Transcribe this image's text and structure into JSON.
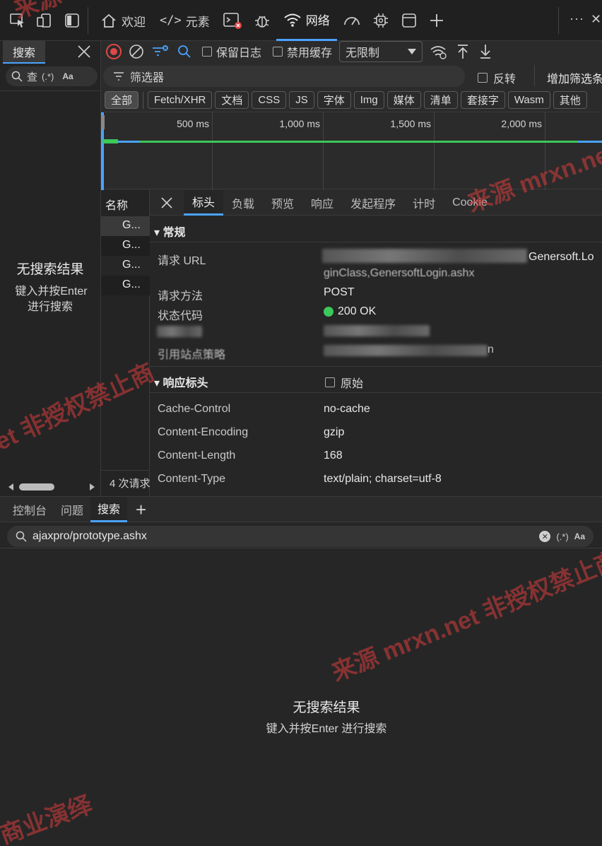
{
  "toolbar": {
    "tabs": [
      {
        "label": "欢迎"
      },
      {
        "label": "元素"
      },
      {
        "label": "网络"
      }
    ],
    "more": "···",
    "close": "✕"
  },
  "left_panel": {
    "tab_label": "搜索",
    "search_placeholder": "查",
    "regex": "(.*)",
    "case": "Aa",
    "no_results": "无搜索结果",
    "hint_line1": "键入并按Enter",
    "hint_line2": "进行搜索"
  },
  "network": {
    "preserve_log": "保留日志",
    "disable_cache": "禁用缓存",
    "throttle": "无限制",
    "filter_placeholder": "筛选器",
    "invert": "反转",
    "more_filters": "增加筛选条件",
    "type_filters": [
      "全部",
      "Fetch/XHR",
      "文档",
      "CSS",
      "JS",
      "字体",
      "Img",
      "媒体",
      "清单",
      "套接字",
      "Wasm",
      "其他"
    ],
    "timeline_ticks": [
      "500 ms",
      "1,000 ms",
      "1,500 ms",
      "2,000 ms"
    ],
    "name_header": "名称",
    "requests": [
      "G...",
      "G...",
      "G...",
      "G..."
    ],
    "status_count": "4 次请求"
  },
  "details": {
    "tabs": [
      "标头",
      "负载",
      "预览",
      "响应",
      "发起程序",
      "计时",
      "Cookie"
    ],
    "general": {
      "title": "▾ 常规",
      "request_url_label": "请求 URL",
      "request_url_value_tail": "Genersoft.Lo",
      "request_url_value_line2": "ginClass,GenersoftLogin.ashx",
      "method_label": "请求方法",
      "method_value": "POST",
      "status_label": "状态代码",
      "status_value": "200 OK",
      "referrer_label": "引用站点策略",
      "referrer_value": "n"
    },
    "response_headers": {
      "title": "▾ 响应标头",
      "raw_label": "原始",
      "rows": [
        {
          "name": "Cache-Control",
          "value": "no-cache"
        },
        {
          "name": "Content-Encoding",
          "value": "gzip"
        },
        {
          "name": "Content-Length",
          "value": "168"
        },
        {
          "name": "Content-Type",
          "value": "text/plain; charset=utf-8"
        }
      ]
    }
  },
  "drawer": {
    "tabs": [
      "控制台",
      "问题",
      "搜索"
    ],
    "add": "+",
    "search_value": "ajaxpro/prototype.ashx",
    "regex": "(.*)",
    "case": "Aa",
    "no_results": "无搜索结果",
    "hint": "键入并按Enter 进行搜索"
  },
  "watermarks": [
    "来源 mrxn.net",
    "来源",
    "et 非授权禁止商",
    "来源 mrxn.net 非授权禁止商",
    "商业演绎"
  ],
  "colors": {
    "accent": "#4aa3ff",
    "record": "#e04848",
    "status_ok": "#3cc85a",
    "watermark": "#d73c3c"
  }
}
